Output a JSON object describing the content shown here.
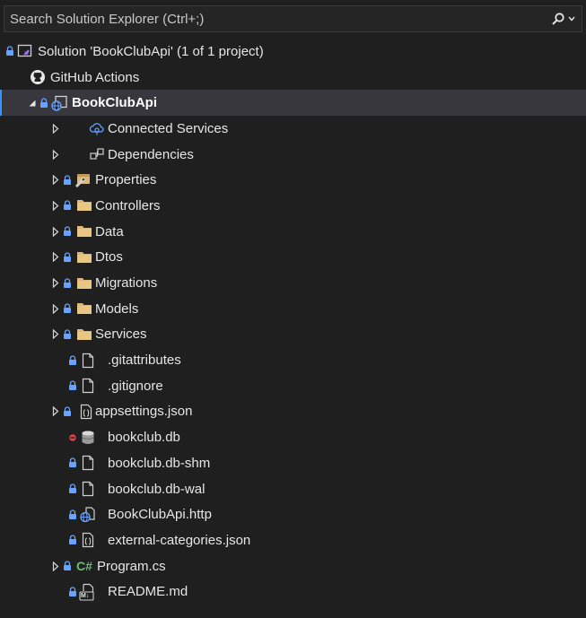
{
  "search": {
    "placeholder": "Search Solution Explorer (Ctrl+;)",
    "icon": "search-icon"
  },
  "colors": {
    "background": "#1f1f1f",
    "selected_row": "#37373d",
    "folder": "#dcb67a",
    "lock": "#6aa2ff",
    "error_dot": "#e0414a",
    "csharp": "#68c16d"
  },
  "tree": {
    "solution": "Solution 'BookClubApi' (1 of 1 project)",
    "github_actions": "GitHub Actions",
    "project": "BookClubApi",
    "items": [
      {
        "label": "Connected Services",
        "icon": "connected-services-icon"
      },
      {
        "label": "Dependencies",
        "icon": "dependencies-icon"
      },
      {
        "label": "Properties",
        "icon": "properties-wrench-icon"
      },
      {
        "label": "Controllers",
        "icon": "folder-icon"
      },
      {
        "label": "Data",
        "icon": "folder-icon"
      },
      {
        "label": "Dtos",
        "icon": "folder-icon"
      },
      {
        "label": "Migrations",
        "icon": "folder-icon"
      },
      {
        "label": "Models",
        "icon": "folder-icon"
      },
      {
        "label": "Services",
        "icon": "folder-icon"
      },
      {
        "label": ".gitattributes",
        "icon": "file-icon"
      },
      {
        "label": ".gitignore",
        "icon": "file-icon"
      },
      {
        "label": "appsettings.json",
        "icon": "json-file-icon"
      },
      {
        "label": "bookclub.db",
        "icon": "database-file-icon"
      },
      {
        "label": "bookclub.db-shm",
        "icon": "file-icon"
      },
      {
        "label": "bookclub.db-wal",
        "icon": "file-icon"
      },
      {
        "label": "BookClubApi.http",
        "icon": "http-file-icon"
      },
      {
        "label": "external-categories.json",
        "icon": "json-file-icon"
      },
      {
        "label": "Program.cs",
        "icon": "csharp-file-icon",
        "badge": "C#"
      },
      {
        "label": "README.md",
        "icon": "markdown-file-icon",
        "badge": "M↓"
      }
    ]
  }
}
